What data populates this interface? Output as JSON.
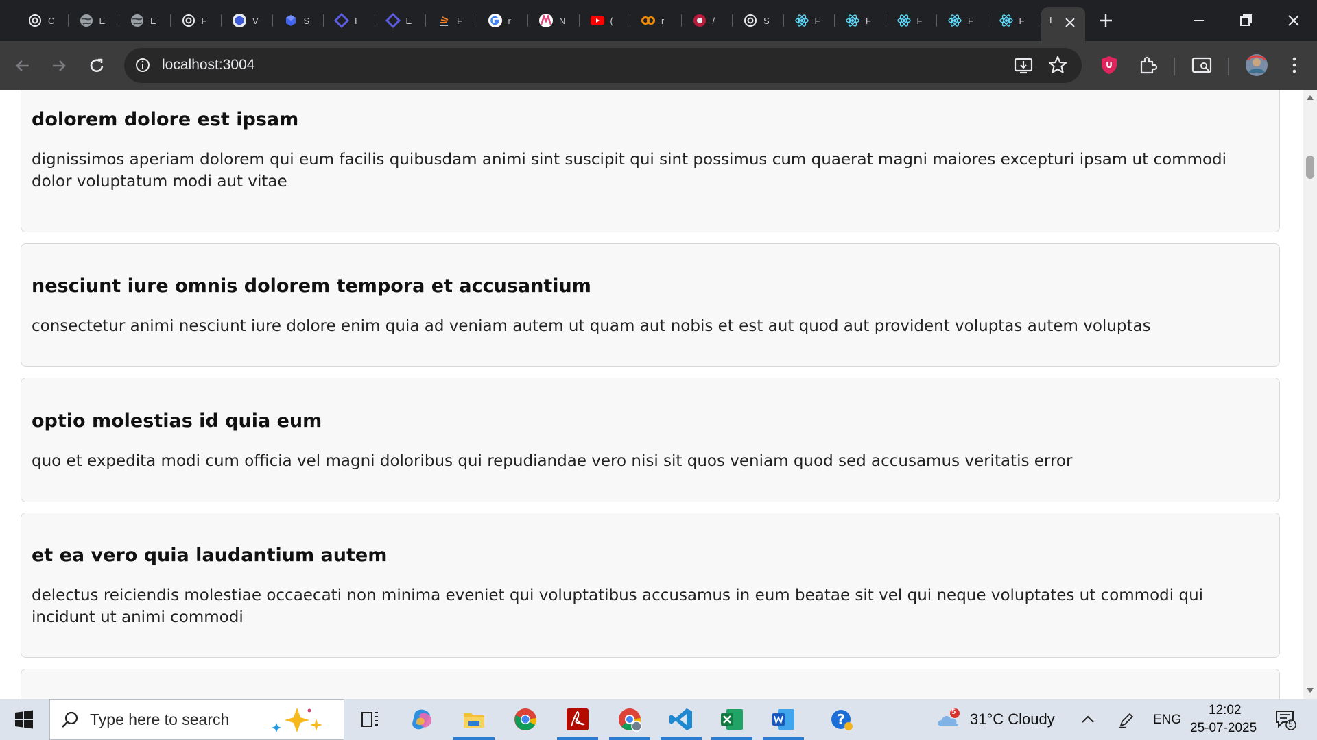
{
  "browser": {
    "tabs": [
      {
        "favicon": "openai-icon",
        "label": "C"
      },
      {
        "favicon": "globe-icon",
        "label": "E"
      },
      {
        "favicon": "globe-icon",
        "label": "E"
      },
      {
        "favicon": "openai-icon",
        "label": "F"
      },
      {
        "favicon": "cube-icon",
        "label": "V"
      },
      {
        "favicon": "cube-blue-icon",
        "label": "S"
      },
      {
        "favicon": "code-diamond-icon",
        "label": "I"
      },
      {
        "favicon": "code-diamond-icon",
        "label": "E"
      },
      {
        "favicon": "stackoverflow-icon",
        "label": "F"
      },
      {
        "favicon": "google-icon",
        "label": "r"
      },
      {
        "favicon": "m-logo-icon",
        "label": "N"
      },
      {
        "favicon": "youtube-icon",
        "label": "("
      },
      {
        "favicon": "infinity-icon",
        "label": "r"
      },
      {
        "favicon": "red-circle-icon",
        "label": "/"
      },
      {
        "favicon": "openai-icon",
        "label": "S"
      },
      {
        "favicon": "react-icon",
        "label": "F"
      },
      {
        "favicon": "react-icon",
        "label": "F"
      },
      {
        "favicon": "react-icon",
        "label": "F"
      },
      {
        "favicon": "react-icon",
        "label": "F"
      },
      {
        "favicon": "react-icon",
        "label": "F"
      }
    ],
    "active_tab_label": "I",
    "url": "localhost:3004"
  },
  "posts": [
    {
      "title": "dolorem dolore est ipsam",
      "body": "dignissimos aperiam dolorem qui eum facilis quibusdam animi sint suscipit qui sint possimus cum quaerat magni maiores excepturi ipsam ut commodi dolor voluptatum modi aut vitae"
    },
    {
      "title": "nesciunt iure omnis dolorem tempora et accusantium",
      "body": "consectetur animi nesciunt iure dolore enim quia ad veniam autem ut quam aut nobis et est aut quod aut provident voluptas autem voluptas"
    },
    {
      "title": "optio molestias id quia eum",
      "body": "quo et expedita modi cum officia vel magni doloribus qui repudiandae vero nisi sit quos veniam quod sed accusamus veritatis error"
    },
    {
      "title": "et ea vero quia laudantium autem",
      "body": "delectus reiciendis molestiae occaecati non minima eveniet qui voluptatibus accusamus in eum beatae sit vel qui neque voluptates ut commodi qui incidunt ut animi commodi"
    }
  ],
  "taskbar": {
    "search_placeholder": "Type here to search",
    "weather": {
      "badge": "5",
      "text": "31°C  Cloudy"
    },
    "language": "ENG",
    "time": "12:02",
    "date": "25-07-2025",
    "notification_count": "5"
  },
  "colors": {
    "tab_strip": "#202124",
    "toolbar": "#3c3c3c",
    "card_bg": "#f8f8f8",
    "taskbar": "#dde3ec",
    "accent": "#2b7cd3"
  }
}
